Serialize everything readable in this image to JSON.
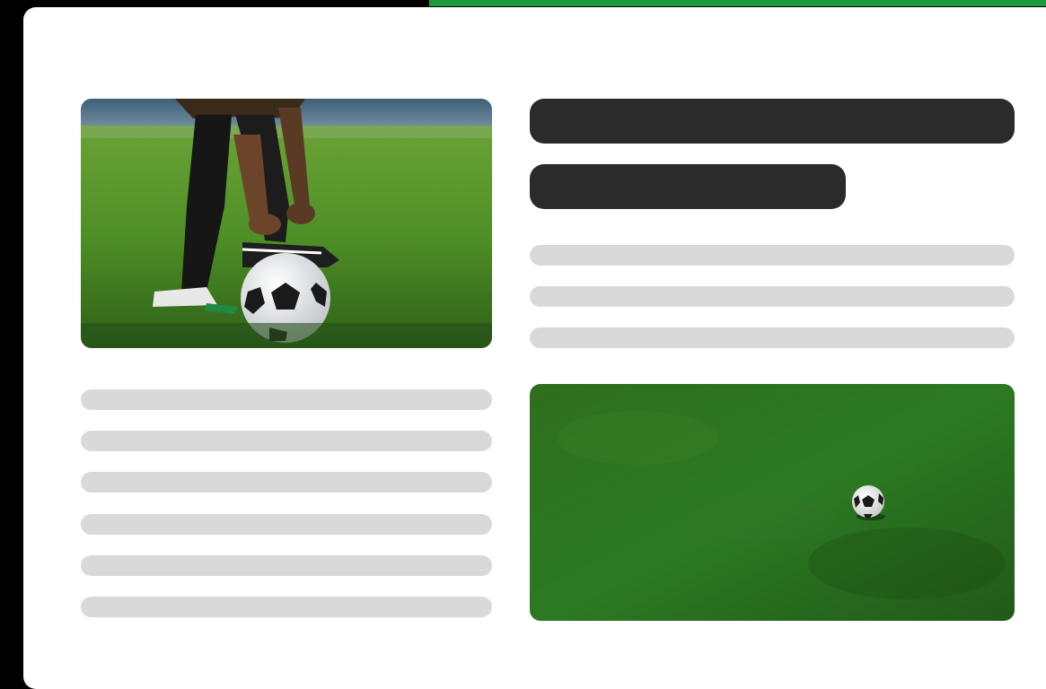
{
  "colors": {
    "background": "#000000",
    "card": "#ffffff",
    "accent": "#1d9b3c",
    "heading_placeholder": "#2b2b2b",
    "text_placeholder": "#d9d9d9",
    "grass": "#2e7d1f"
  },
  "images": {
    "top_left": "player-tying-boot-on-soccer-ball",
    "bottom_right": "soccer-ball-on-grass-field"
  },
  "placeholders": {
    "heading_lines": 2,
    "right_text_lines": 3,
    "left_text_lines": 6
  }
}
